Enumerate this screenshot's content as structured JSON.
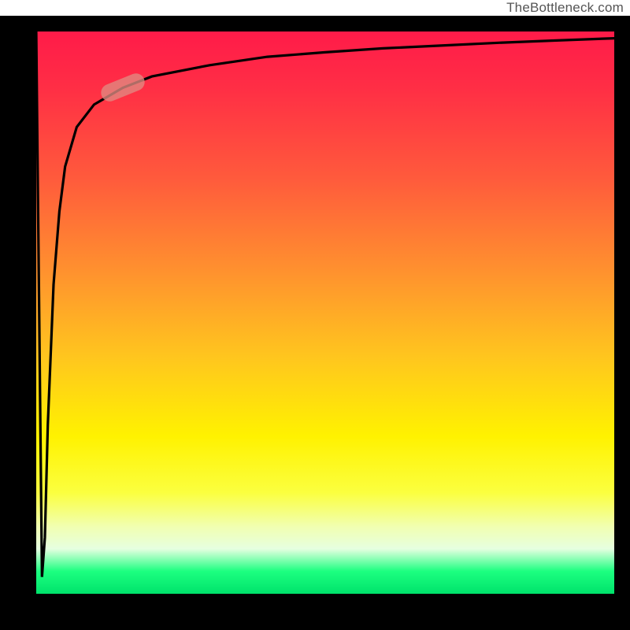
{
  "attribution": "TheBottleneck.com",
  "colors": {
    "gradient_top": "#ff1b49",
    "gradient_mid": "#fff200",
    "gradient_bottom": "#00e36b",
    "frame": "#000000",
    "curve": "#000000",
    "marker": "#e08b82"
  },
  "chart_data": {
    "type": "line",
    "title": "",
    "xlabel": "",
    "ylabel": "",
    "xlim": [
      0,
      100
    ],
    "ylim": [
      0,
      100
    ],
    "grid": false,
    "legend": null,
    "series": [
      {
        "name": "curve",
        "x": [
          0,
          1,
          1.5,
          2,
          3,
          4,
          5,
          7,
          10,
          15,
          20,
          30,
          40,
          50,
          60,
          70,
          80,
          90,
          100
        ],
        "y": [
          100,
          3,
          10,
          30,
          55,
          68,
          76,
          83,
          87,
          90,
          92,
          94,
          95.5,
          96.3,
          97,
          97.5,
          98,
          98.4,
          98.8
        ]
      }
    ],
    "marker": {
      "x": 15,
      "y": 90
    },
    "background_gradient": [
      "#ff1b49",
      "#fff200",
      "#00e36b"
    ]
  }
}
